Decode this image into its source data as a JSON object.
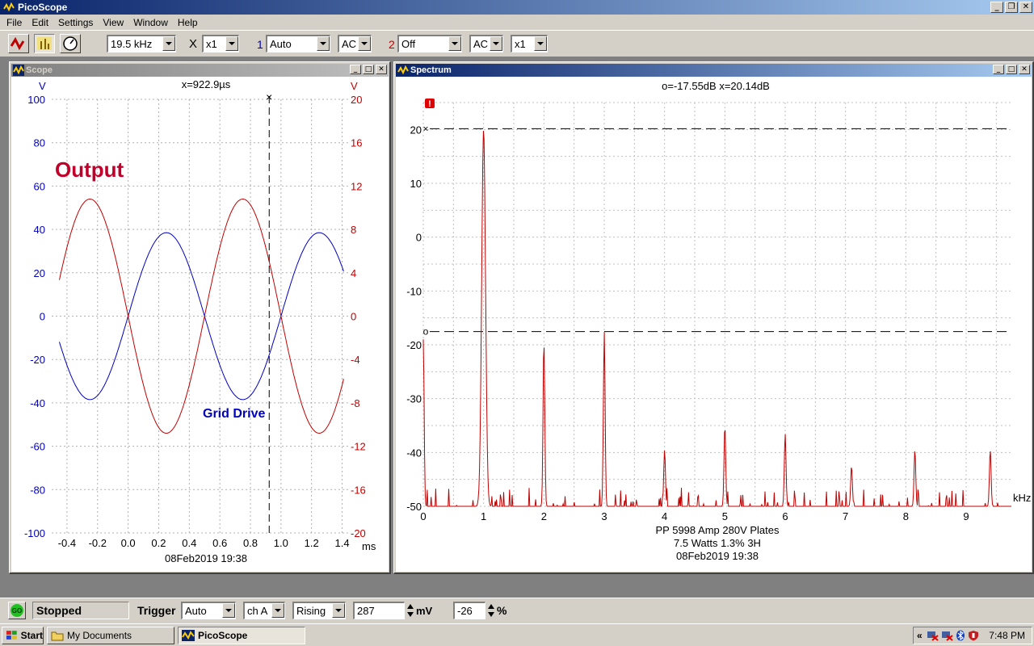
{
  "app": {
    "title": "PicoScope"
  },
  "menu": [
    "File",
    "Edit",
    "Settings",
    "View",
    "Window",
    "Help"
  ],
  "toolbar": {
    "timebase": "19.5 kHz",
    "x_label": "X",
    "zoom": "x1",
    "ch1_label": "1",
    "ch1_range": "Auto",
    "ch1_coupling": "AC",
    "ch2_label": "2",
    "ch2_range": "Off",
    "ch2_coupling": "AC",
    "ch2_zoom": "x1"
  },
  "scope_window": {
    "title": "Scope",
    "cursor_readout": "x=922.9µs",
    "left_unit": "V",
    "right_unit": "V",
    "left_ticks": [
      "100",
      "80",
      "60",
      "40",
      "20",
      "0",
      "-20",
      "-40",
      "-60",
      "-80",
      "-100"
    ],
    "right_ticks": [
      "20",
      "16",
      "12",
      "8",
      "4",
      "0",
      "-4",
      "-8",
      "-12",
      "-16",
      "-20"
    ],
    "x_ticks": [
      "-0.4",
      "-0.2",
      "0.0",
      "0.2",
      "0.4",
      "0.6",
      "0.8",
      "1.0",
      "1.2",
      "1.4"
    ],
    "x_unit": "ms",
    "annotation_output": "Output",
    "annotation_grid": "Grid Drive",
    "timestamp": "08Feb2019  19:38",
    "colors": {
      "blue": "#0000c0",
      "red": "#c00000",
      "output_label": "#c0002a"
    }
  },
  "spectrum_window": {
    "title": "Spectrum",
    "cursor_readout": "o=-17.55dB  x=20.14dB",
    "y_ticks": [
      "20",
      "10",
      "0",
      "-10",
      "-20",
      "-30",
      "-40",
      "-50"
    ],
    "x_ticks": [
      "0",
      "1",
      "2",
      "3",
      "4",
      "5",
      "6",
      "7",
      "8",
      "9"
    ],
    "x_unit": "kHz",
    "cursor_x_marker": "×",
    "cursor_o_marker": "o",
    "caption_line1": "PP 5998  Amp 280V Plates",
    "caption_line2": "7.5 Watts 1.3% 3H",
    "caption_line3": "08Feb2019  19:38",
    "warning_icon": "!"
  },
  "chart_data": [
    {
      "type": "line",
      "x": [
        -0.5,
        1.45
      ],
      "xlabel": "ms",
      "xlim": [
        -0.5,
        1.45
      ],
      "grid": true,
      "series": [
        {
          "name": "Grid Drive",
          "axis": "left",
          "ylim": [
            -100,
            100
          ],
          "shape": "sine",
          "amplitude": 38.5,
          "frequency_khz": 1.0,
          "phase_peak_ms": 0.25,
          "color": "#0000c0"
        },
        {
          "name": "Output",
          "axis": "right",
          "ylim": [
            -20,
            20
          ],
          "shape": "sine",
          "amplitude": 10.8,
          "frequency_khz": 1.0,
          "phase_peak_ms": 0.75,
          "color": "#c00000"
        }
      ],
      "cursor_x_ms": 0.9229
    },
    {
      "type": "line",
      "xlabel": "kHz",
      "xlim": [
        0,
        9.75
      ],
      "ylim": [
        -50,
        25
      ],
      "grid": true,
      "cursor_levels_db": [
        20.14,
        -17.55
      ],
      "peaks": [
        {
          "f": 0.0,
          "db": -19
        },
        {
          "f": 1.0,
          "db": 20.14
        },
        {
          "f": 2.0,
          "db": -19.2
        },
        {
          "f": 3.0,
          "db": -17.55
        },
        {
          "f": 4.0,
          "db": -39.5
        },
        {
          "f": 5.0,
          "db": -35
        },
        {
          "f": 6.0,
          "db": -36.5
        },
        {
          "f": 7.1,
          "db": -42.5
        },
        {
          "f": 8.15,
          "db": -39.5
        },
        {
          "f": 9.4,
          "db": -39.5
        }
      ]
    }
  ],
  "status": {
    "go_label": "GO",
    "state": "Stopped",
    "trigger_label": "Trigger",
    "trigger_mode": "Auto",
    "trigger_channel": "ch A",
    "trigger_edge": "Rising",
    "trigger_level": "287",
    "level_unit": "mV",
    "pretrigger": "-26",
    "pretrigger_unit": "%"
  },
  "taskbar": {
    "start": "Start",
    "task1": "My Documents",
    "task2": "PicoScope",
    "tray_chevron": "«",
    "clock": "7:48 PM"
  }
}
